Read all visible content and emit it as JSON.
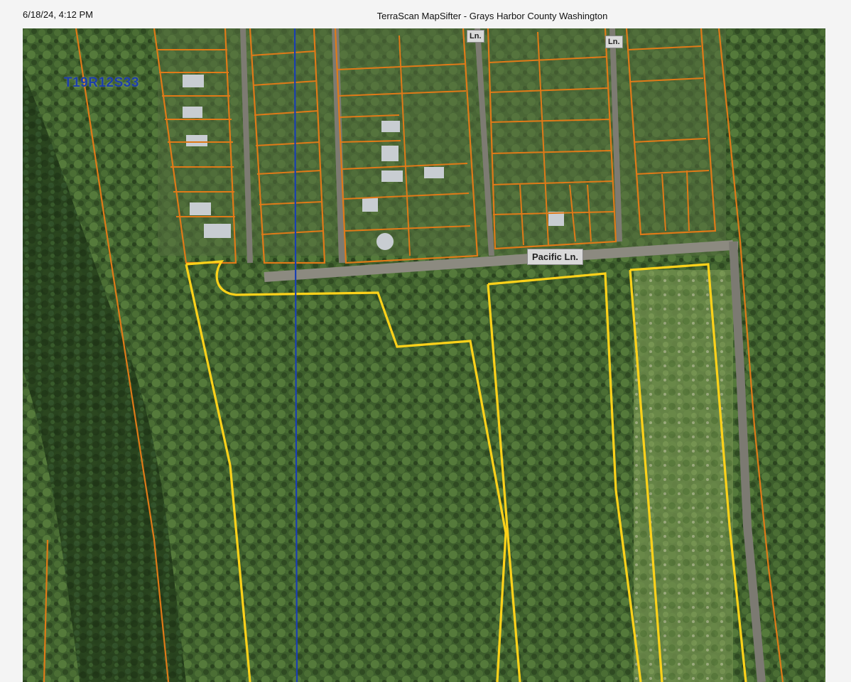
{
  "header": {
    "date_time": "6/18/24, 4:12 PM",
    "title": "TerraScan MapSifter - Grays Harbor County Washington"
  },
  "map": {
    "section_label": "T19R12S33",
    "road_labels": [
      "Pacific Ln."
    ],
    "street_tags": [
      "Ln.",
      "Ln."
    ],
    "colors": {
      "parcel_line": "#e07a18",
      "selected_parcel": "#ffd21a",
      "section_line": "#1b3fb3",
      "vegetation": "#3b5a2a",
      "road": "#8c8a80"
    }
  }
}
